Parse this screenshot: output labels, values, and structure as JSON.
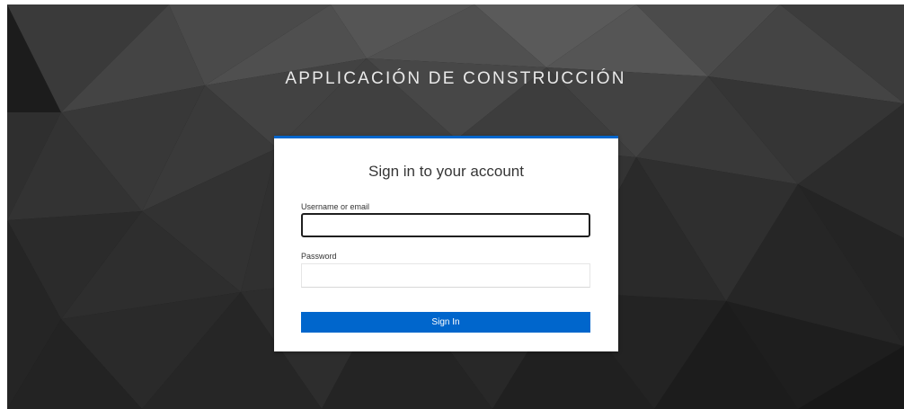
{
  "app": {
    "brand_title": "APPLICACIÓN DE CONSTRUCCIÓN"
  },
  "login": {
    "title": "Sign in to your account",
    "username_label": "Username or email",
    "username_value": "",
    "password_label": "Password",
    "password_value": "",
    "submit_label": "Sign In"
  },
  "colors": {
    "accent": "#0066cc",
    "background": "#1b1b1b"
  }
}
